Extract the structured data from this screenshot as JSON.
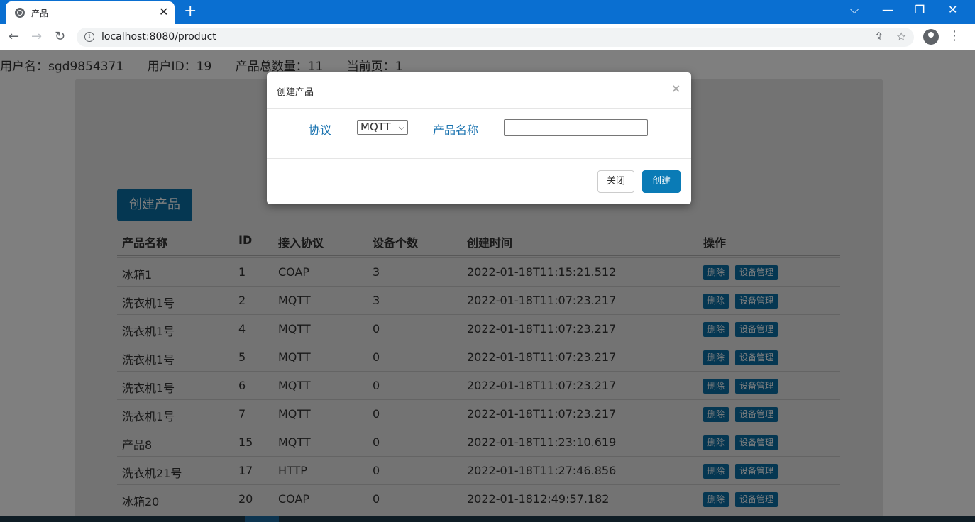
{
  "browser": {
    "tab_title": "产品",
    "tab_close": "✕",
    "new_tab": "+",
    "url": "localhost:8080/product",
    "info_icon": "i",
    "window_controls": [
      "⌵",
      "—",
      "❐",
      "✕"
    ]
  },
  "userbar": {
    "username": "用户名：sgd9854371",
    "user_id": "用户ID：19",
    "product_total": "产品总数量：11",
    "current_page": "当前页：1"
  },
  "page": {
    "create_button": "创建产品"
  },
  "table": {
    "headers": [
      "产品名称",
      "ID",
      "接入协议",
      "设备个数",
      "创建时间",
      "操作"
    ],
    "delete_label": "删除",
    "device_label": "设备管理",
    "rows": [
      {
        "name": "冰箱1",
        "id": "1",
        "protocol": "COAP",
        "count": "3",
        "created": "2022-01-18T11:15:21.512"
      },
      {
        "name": "洗衣机1号",
        "id": "2",
        "protocol": "MQTT",
        "count": "3",
        "created": "2022-01-18T11:07:23.217"
      },
      {
        "name": "洗衣机1号",
        "id": "4",
        "protocol": "MQTT",
        "count": "0",
        "created": "2022-01-18T11:07:23.217"
      },
      {
        "name": "洗衣机1号",
        "id": "5",
        "protocol": "MQTT",
        "count": "0",
        "created": "2022-01-18T11:07:23.217"
      },
      {
        "name": "洗衣机1号",
        "id": "6",
        "protocol": "MQTT",
        "count": "0",
        "created": "2022-01-18T11:07:23.217"
      },
      {
        "name": "洗衣机1号",
        "id": "7",
        "protocol": "MQTT",
        "count": "0",
        "created": "2022-01-18T11:07:23.217"
      },
      {
        "name": "产品8",
        "id": "15",
        "protocol": "MQTT",
        "count": "0",
        "created": "2022-01-18T11:23:10.619"
      },
      {
        "name": "洗衣机21号",
        "id": "17",
        "protocol": "HTTP",
        "count": "0",
        "created": "2022-01-18T11:27:46.856"
      },
      {
        "name": "冰箱20",
        "id": "20",
        "protocol": "COAP",
        "count": "0",
        "created": "2022-01-1812:49:57.182"
      }
    ]
  },
  "modal": {
    "title": "创建产品",
    "close_x": "×",
    "protocol_label": "协议",
    "protocol_value": "MQTT",
    "name_label": "产品名称",
    "name_value": "",
    "close_button": "关闭",
    "create_button": "创建"
  },
  "colors": {
    "accent": "#0a6fa5",
    "chrome": "#0a6fd1",
    "link_label": "#1a73b0"
  }
}
